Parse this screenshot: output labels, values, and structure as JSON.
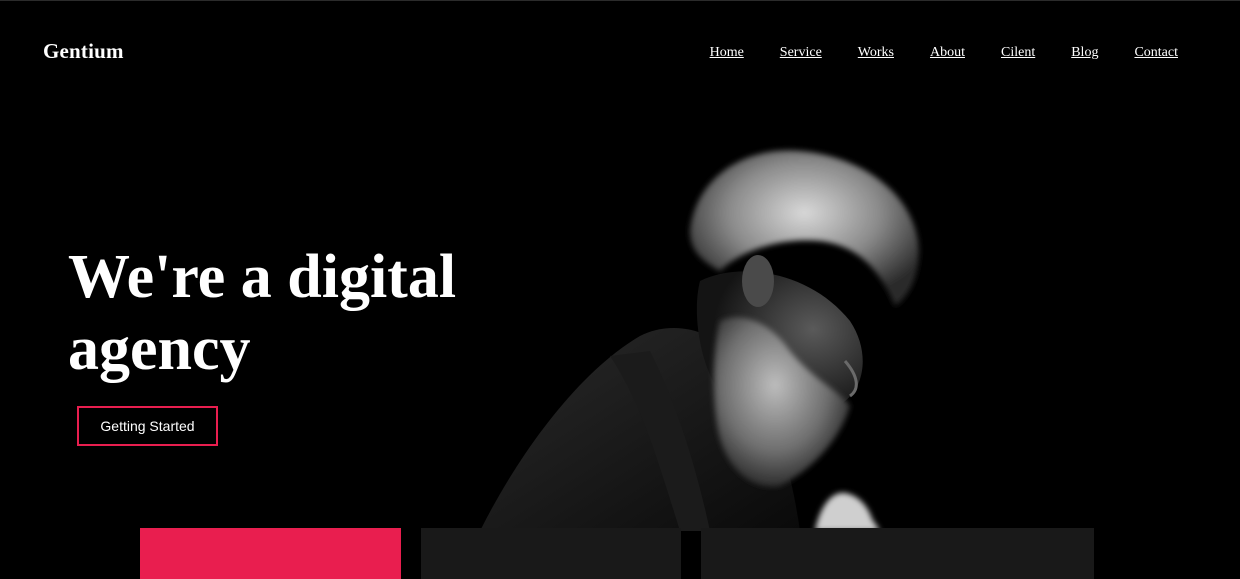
{
  "brand": {
    "logo": "Gentium",
    "accent_color": "#e91e4f"
  },
  "nav": {
    "items": [
      {
        "label": "Home"
      },
      {
        "label": "Service"
      },
      {
        "label": "Works"
      },
      {
        "label": "About"
      },
      {
        "label": "Cilent"
      },
      {
        "label": "Blog"
      },
      {
        "label": "Contact"
      }
    ]
  },
  "hero": {
    "headline_line1": "We're a digital",
    "headline_line2": "agency",
    "cta_label": "Getting Started",
    "image_subject": "bearded-man-portrait"
  },
  "cards": [
    {
      "color": "#e91e4f"
    },
    {
      "color": "#191919"
    },
    {
      "color": "#191919"
    }
  ]
}
